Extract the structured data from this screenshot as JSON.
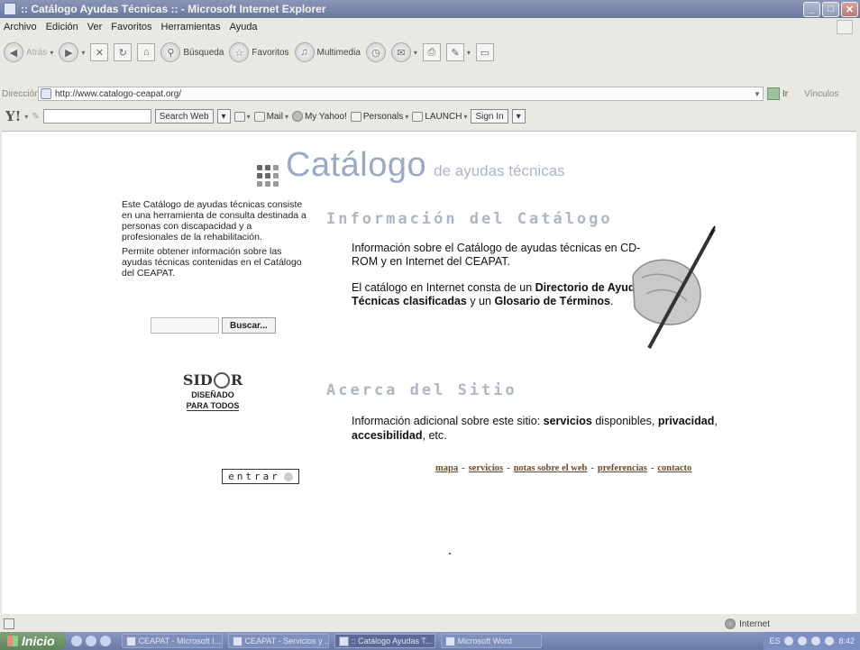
{
  "window": {
    "title": ":: Catálogo Ayudas Técnicas :: - Microsoft Internet Explorer"
  },
  "menu": [
    "Archivo",
    "Edición",
    "Ver",
    "Favoritos",
    "Herramientas",
    "Ayuda"
  ],
  "toolbar": {
    "back": "Atrás",
    "search": "Búsqueda",
    "favorites": "Favoritos",
    "multimedia": "Multimedia"
  },
  "address": {
    "label": "Dirección",
    "url": "http://www.catalogo-ceapat.org/",
    "go": "Ir",
    "links": "Vínculos"
  },
  "yahoo": {
    "logo": "Y!",
    "search_button": "Search Web",
    "mail": "Mail",
    "my_yahoo": "My Yahoo!",
    "personals": "Personals",
    "launch": "LAUNCH",
    "sign_in": "Sign In"
  },
  "page": {
    "logo_main": "Catálogo",
    "logo_sub": "de ayudas técnicas",
    "intro_1": "Este Catálogo de ayudas técnicas consiste en una herramienta de consulta destinada a personas con discapacidad y a profesionales de la rehabilitación.",
    "intro_2": "Permite obtener información sobre las ayudas técnicas contenidas en el Catálogo del CEAPAT.",
    "search_button": "Buscar...",
    "badge_logo_left": "SID",
    "badge_logo_right": "R",
    "badge_line1": "DISEÑADO",
    "badge_line2": "PARA TODOS",
    "info_heading": "Información del Catálogo",
    "info_p1": "Información sobre el Catálogo de ayudas técnicas en CD-ROM y en Internet del CEAPAT.",
    "info_p2_a": "El catálogo en Internet consta de un ",
    "info_p2_b": "Directorio de Ayudas Técnicas clasificadas",
    "info_p2_c": " y un ",
    "info_p2_d": "Glosario de Términos",
    "info_p2_e": ".",
    "about_heading": "Acerca del Sitio",
    "about_a": "Información adicional sobre este sitio: ",
    "about_b": "servicios",
    "about_c": " disponibles, ",
    "about_d": "privacidad",
    "about_e": ", ",
    "about_f": "accesibilidad",
    "about_g": ", etc.",
    "enter": "entrar",
    "footer_links": [
      "mapa",
      "servicios",
      "notas sobre el web",
      "preferencias",
      "contacto"
    ],
    "footer_sep": "-"
  },
  "status": {
    "zone": "Internet"
  },
  "taskbar": {
    "start": "Inicio",
    "tasks": [
      "CEAPAT - Microsoft I...",
      "CEAPAT - Servicios y ...",
      ":: Catálogo Ayudas T...",
      "Microsoft Word"
    ],
    "lang": "ES",
    "clock": "8:42"
  },
  "colors": {
    "heading": "#aeb5c4",
    "logo": "#9aa9c4",
    "link": "#6b4a2a"
  }
}
